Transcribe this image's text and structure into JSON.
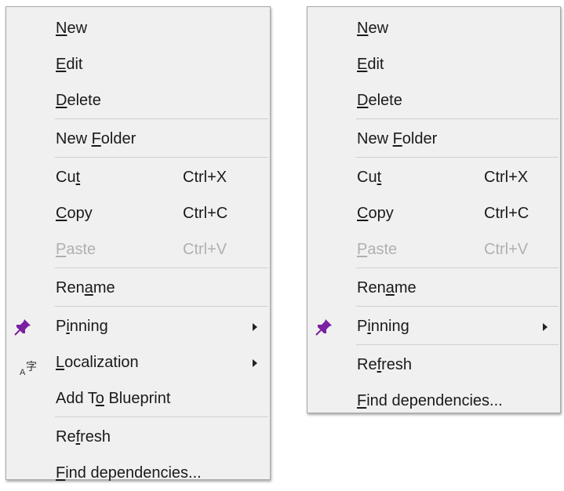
{
  "menu_a": {
    "items": [
      {
        "pre": "",
        "key": "N",
        "post": "ew"
      },
      {
        "pre": "",
        "key": "E",
        "post": "dit"
      },
      {
        "pre": "",
        "key": "D",
        "post": "elete"
      },
      {
        "pre": "New ",
        "key": "F",
        "post": "older"
      },
      {
        "pre": "Cu",
        "key": "t",
        "post": "",
        "shortcut": "Ctrl+X"
      },
      {
        "pre": "",
        "key": "C",
        "post": "opy",
        "shortcut": "Ctrl+C"
      },
      {
        "pre": "",
        "key": "P",
        "post": "aste",
        "shortcut": "Ctrl+V"
      },
      {
        "pre": "Ren",
        "key": "a",
        "post": "me"
      },
      {
        "pre": "P",
        "key": "i",
        "post": "nning"
      },
      {
        "pre": "",
        "key": "L",
        "post": "ocalization"
      },
      {
        "pre": "Add T",
        "key": "o",
        "post": " Blueprint"
      },
      {
        "pre": "Re",
        "key": "f",
        "post": "resh"
      },
      {
        "pre": "",
        "key": "F",
        "post": "ind dependencies..."
      }
    ]
  },
  "menu_b": {
    "items": [
      {
        "pre": "",
        "key": "N",
        "post": "ew"
      },
      {
        "pre": "",
        "key": "E",
        "post": "dit"
      },
      {
        "pre": "",
        "key": "D",
        "post": "elete"
      },
      {
        "pre": "New ",
        "key": "F",
        "post": "older"
      },
      {
        "pre": "Cu",
        "key": "t",
        "post": "",
        "shortcut": "Ctrl+X"
      },
      {
        "pre": "",
        "key": "C",
        "post": "opy",
        "shortcut": "Ctrl+C"
      },
      {
        "pre": "",
        "key": "P",
        "post": "aste",
        "shortcut": "Ctrl+V"
      },
      {
        "pre": "Ren",
        "key": "a",
        "post": "me"
      },
      {
        "pre": "P",
        "key": "i",
        "post": "nning"
      },
      {
        "pre": "Re",
        "key": "f",
        "post": "resh"
      },
      {
        "pre": "",
        "key": "F",
        "post": "ind dependencies..."
      }
    ]
  },
  "icons": {
    "pin": "pushpin-icon",
    "localize": "localization-icon",
    "submenu": "submenu-arrow-icon"
  },
  "colors": {
    "pin": "#7b1fa2",
    "menu_bg": "#f0f0f0",
    "disabled_text": "#b0b0b0"
  }
}
